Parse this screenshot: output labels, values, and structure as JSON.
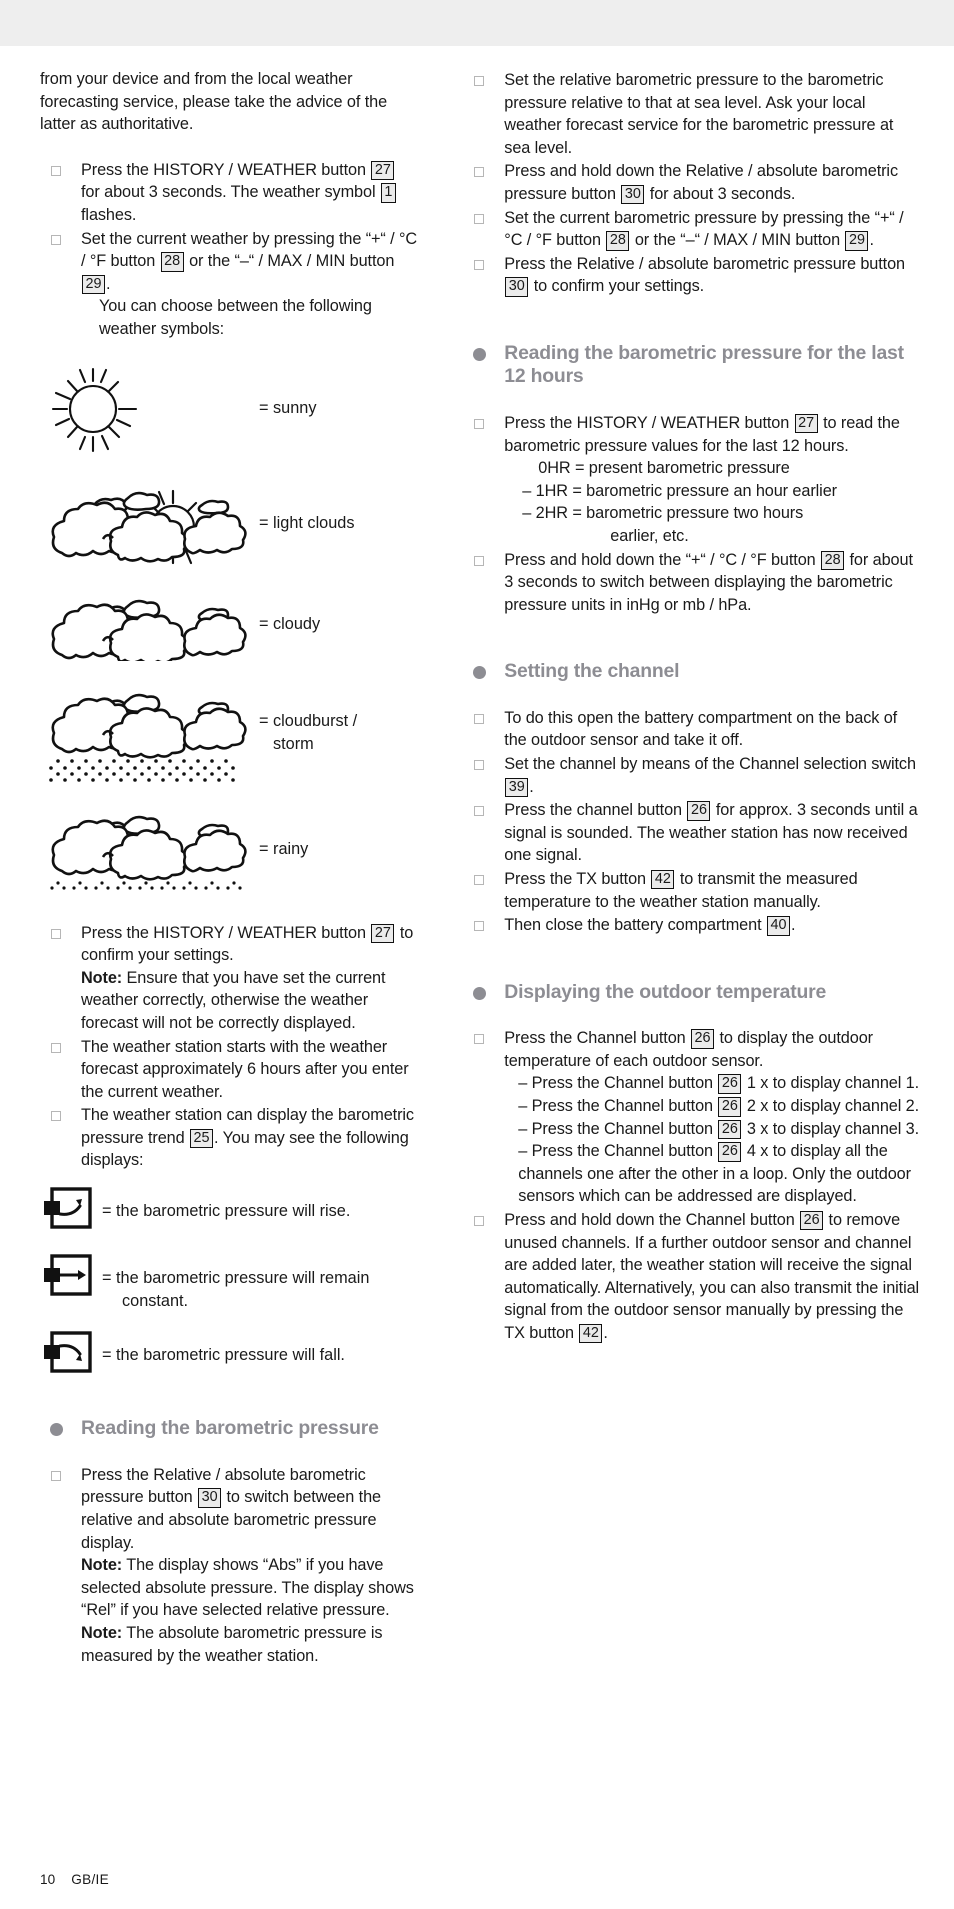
{
  "page": {
    "number": "10",
    "locale": "GB/IE"
  },
  "left": {
    "intro": "from your device and from the local weather forecasting service, please take the advice of the latter as authoritative.",
    "items": [
      {
        "parts": [
          {
            "t": "Press the HISTORY / WEATHER button "
          },
          {
            "ref": "27"
          },
          {
            "t": " for about 3 seconds. The weather symbol "
          },
          {
            "ref": "1"
          },
          {
            "t": " flashes."
          }
        ]
      },
      {
        "parts": [
          {
            "t": "Set the current weather by pressing the “+“ / °C / °F button "
          },
          {
            "ref": "28"
          },
          {
            "t": " or the “–“ / MAX / MIN button "
          },
          {
            "ref": "29"
          },
          {
            "t": "."
          }
        ],
        "extra": "You can choose between the following weather symbols:"
      }
    ],
    "symbols": [
      {
        "icon": "sunny-icon",
        "label": "= sunny"
      },
      {
        "icon": "light-clouds-icon",
        "label": "= light clouds"
      },
      {
        "icon": "cloudy-icon",
        "label": "= cloudy"
      },
      {
        "icon": "cloudburst-icon",
        "label": "= cloudburst /",
        "label2": "storm"
      },
      {
        "icon": "rainy-icon",
        "label": "= rainy"
      }
    ],
    "items2": [
      {
        "parts": [
          {
            "t": "Press the HISTORY / WEATHER button "
          },
          {
            "ref": "27"
          },
          {
            "t": " to confirm your settings."
          }
        ],
        "note_label": "Note:",
        "note": " Ensure that you have set the current weather correctly, otherwise the weather forecast will not be correctly displayed."
      },
      {
        "parts": [
          {
            "t": "The weather station starts with the weather forecast approximately 6 hours after you enter the current weather."
          }
        ]
      },
      {
        "parts": [
          {
            "t": "The weather station can display the barometric pressure trend "
          },
          {
            "ref": "25"
          },
          {
            "t": ". You may see the following displays:"
          }
        ]
      }
    ],
    "trends": [
      {
        "icon": "pressure-rise-icon",
        "label": "= the barometric pressure will rise."
      },
      {
        "icon": "pressure-constant-icon",
        "label": "= the barometric pressure will remain",
        "label2": "constant."
      },
      {
        "icon": "pressure-fall-icon",
        "label": "= the barometric pressure will fall."
      }
    ],
    "heading": "Reading the barometric pressure",
    "items3": [
      {
        "parts": [
          {
            "t": "Press the Relative / absolute barometric pressure button "
          },
          {
            "ref": "30"
          },
          {
            "t": " to switch between the relative and absolute barometric pressure display."
          }
        ],
        "note_label": "Note:",
        "note": " The display shows “Abs” if you have selected absolute pressure. The display shows “Rel” if you have selected relative pressure.",
        "note2_label": "Note:",
        "note2": " The absolute barometric pressure is measured by the weather station."
      }
    ]
  },
  "right": {
    "items1": [
      {
        "parts": [
          {
            "t": "Set the relative barometric pressure to the barometric pressure relative to that at sea level. Ask your local weather forecast service for the barometric pressure at sea level."
          }
        ]
      },
      {
        "parts": [
          {
            "t": "Press and hold down the Relative / absolute barometric pressure button "
          },
          {
            "ref": "30"
          },
          {
            "t": " for about 3 seconds."
          }
        ]
      },
      {
        "parts": [
          {
            "t": "Set the current barometric pressure by pressing the “+“ / °C / °F button "
          },
          {
            "ref": "28"
          },
          {
            "t": " or the “–“ / MAX / MIN button "
          },
          {
            "ref": "29"
          },
          {
            "t": "."
          }
        ]
      },
      {
        "parts": [
          {
            "t": "Press the Relative / absolute barometric pressure button "
          },
          {
            "ref": "30"
          },
          {
            "t": " to confirm your settings."
          }
        ]
      }
    ],
    "heading1": "Reading the barometric pressure for the last 12 hours",
    "items2": [
      {
        "parts": [
          {
            "t": "Press the HISTORY / WEATHER button "
          },
          {
            "ref": "27"
          },
          {
            "t": " to read the barometric pressure values for the last 12 hours."
          }
        ],
        "sublines": [
          "0HR = present barometric pressure",
          "– 1HR = barometric pressure an hour earlier",
          "– 2HR = barometric pressure two hours",
          "earlier, etc."
        ]
      },
      {
        "parts": [
          {
            "t": "Press and hold down the “+“ / °C / °F button "
          },
          {
            "ref": "28"
          },
          {
            "t": " for about 3 seconds to switch between displaying the barometric pressure units in inHg or mb / hPa."
          }
        ]
      }
    ],
    "heading2": "Setting the channel",
    "items3": [
      {
        "parts": [
          {
            "t": "To do this open the battery compartment on the back of the outdoor sensor and take it off."
          }
        ]
      },
      {
        "parts": [
          {
            "t": "Set the channel by means of the Channel selection switch "
          },
          {
            "ref": "39"
          },
          {
            "t": "."
          }
        ]
      },
      {
        "parts": [
          {
            "t": "Press the channel button "
          },
          {
            "ref": "26"
          },
          {
            "t": " for approx. 3 seconds until a signal is sounded. The weather station has now received one signal."
          }
        ]
      },
      {
        "parts": [
          {
            "t": "Press the TX button "
          },
          {
            "ref": "42"
          },
          {
            "t": " to transmit the measured temperature to the weather station manually."
          }
        ]
      },
      {
        "parts": [
          {
            "t": "Then close the battery compartment "
          },
          {
            "ref": "40"
          },
          {
            "t": "."
          }
        ]
      }
    ],
    "heading3": "Displaying the outdoor temperature",
    "items4": [
      {
        "parts": [
          {
            "t": "Press the Channel button "
          },
          {
            "ref": "26"
          },
          {
            "t": " to display the outdoor temperature of each outdoor sensor."
          }
        ],
        "dashes": [
          [
            {
              "t": "– Press the Channel button "
            },
            {
              "ref": "26"
            },
            {
              "t": " 1 x to display channel 1."
            }
          ],
          [
            {
              "t": "– Press the Channel button "
            },
            {
              "ref": "26"
            },
            {
              "t": " 2 x to display channel 2."
            }
          ],
          [
            {
              "t": "– Press the Channel button "
            },
            {
              "ref": "26"
            },
            {
              "t": " 3 x to display channel 3."
            }
          ],
          [
            {
              "t": "– Press the Channel button "
            },
            {
              "ref": "26"
            },
            {
              "t": " 4 x to display all the channels one after the other in a loop. Only the outdoor sensors which can be addressed are displayed."
            }
          ]
        ]
      },
      {
        "parts": [
          {
            "t": "Press and hold down the Channel button "
          },
          {
            "ref": "26"
          },
          {
            "t": " to remove unused channels. If a further outdoor sensor and channel are added later, the weather station will receive the signal automatically. Alternatively, you can also transmit the initial signal from the outdoor sensor manually by pressing the TX button "
          },
          {
            "ref": "42"
          },
          {
            "t": "."
          }
        ]
      }
    ]
  },
  "colors": {
    "heading": "#8d8d93",
    "key_box_fill": "#ebebeb",
    "key_box_border": "#111111",
    "band": "#eeeeee"
  }
}
